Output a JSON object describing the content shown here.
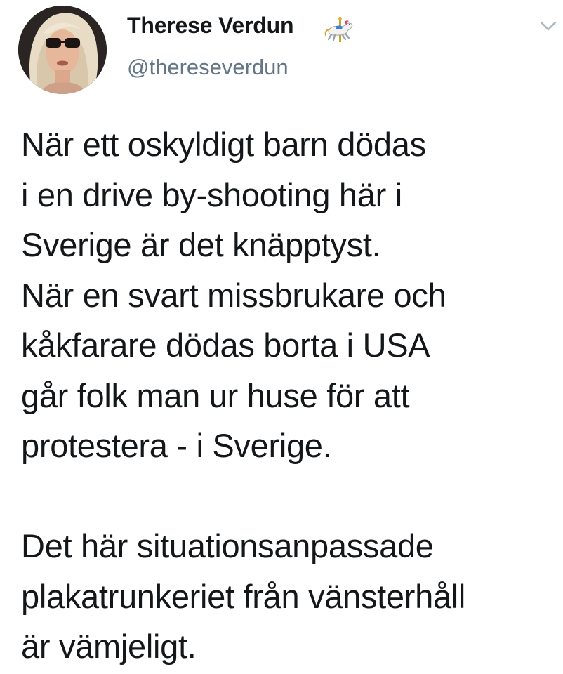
{
  "user": {
    "display_name": "Therese Verdun",
    "name_emoji": "carousel-horse-emoji",
    "handle": "@thereseverdun"
  },
  "menu": {
    "icon": "chevron-down-icon"
  },
  "tweet": {
    "lines": [
      "När ett oskyldigt barn dödas",
      "i en drive by-shooting här i",
      "Sverige är det knäpptyst.",
      "När en svart missbrukare och",
      "kåkfarare dödas borta i USA",
      "går folk man ur huse för att",
      "protestera - i Sverige.",
      "",
      "Det här situationsanpassade",
      "plakatrunkeriet från vänsterhåll",
      "är vämjeligt."
    ]
  },
  "colors": {
    "text": "#14171a",
    "secondary": "#657786",
    "chevron": "#aab8c2",
    "background": "#ffffff"
  }
}
